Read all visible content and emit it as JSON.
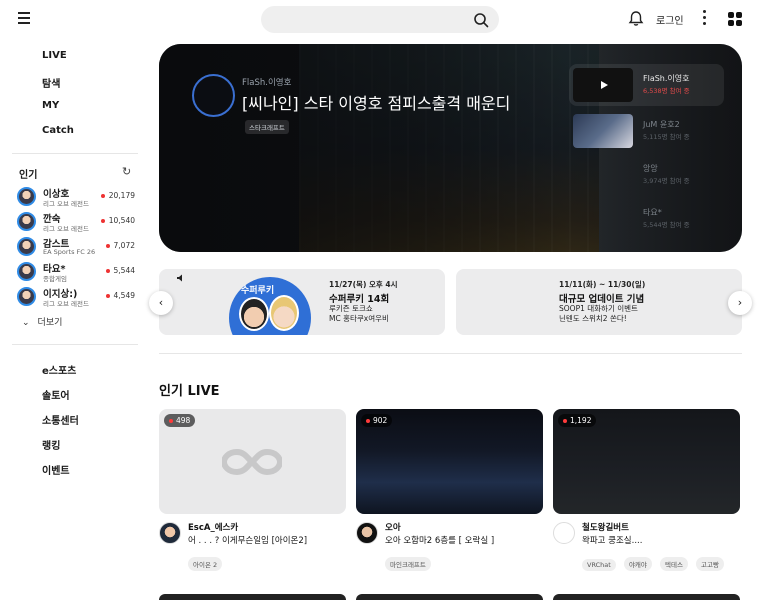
{
  "header": {
    "search_placeholder": "",
    "login_label": "로그인"
  },
  "sidebar": {
    "main_nav": [
      "LIVE",
      "탐색",
      "MY",
      "Catch"
    ],
    "popular_title": "인기",
    "streamers": [
      {
        "name": "이상호",
        "category": "리그 오브 레전드",
        "viewers": "20,179"
      },
      {
        "name": "깐숙",
        "category": "리그 오브 레전드",
        "viewers": "10,540"
      },
      {
        "name": "감스트",
        "category": "EA Sports FC 26",
        "viewers": "7,072"
      },
      {
        "name": "타요*",
        "category": "종합게임",
        "viewers": "5,544"
      },
      {
        "name": "이지상:)",
        "category": "리그 오브 레전드",
        "viewers": "4,549"
      }
    ],
    "more_label": "더보기",
    "extra_nav": [
      "e스포츠",
      "솔토어",
      "소통센터",
      "랭킹",
      "이벤트"
    ]
  },
  "banner": {
    "streamer": "FlaSh.이영호",
    "title": "[씨나인] 스타 이영호 점피스출격 매운디",
    "tag": "스타크래프트",
    "side_streams": [
      {
        "name": "FlaSh.이영호",
        "viewers": "6,538명 참여 중"
      },
      {
        "name": "JuM 윤호2",
        "viewers": "5,115명 참여 중"
      },
      {
        "name": "앙앙",
        "viewers": "3,974명 참여 중"
      },
      {
        "name": "타요*",
        "viewers": "5,544명 참여 중"
      }
    ]
  },
  "promos": [
    {
      "date": "11/27(목) 오후 4시",
      "title": "수퍼루키 14회",
      "sub1": "루키즌 토크쇼",
      "sub2": "MC 홍타쿠x여우비",
      "badge": "수퍼루키"
    },
    {
      "date": "11/11(화) ~ 11/30(일)",
      "title": "대규모 업데이트 기념",
      "sub1": "SOOP1 대화하기 이벤트",
      "sub2": "닌텐도 스위치2 쏜다!"
    }
  ],
  "section_title": "인기 LIVE",
  "live_cards": [
    {
      "viewers": "498",
      "channel": "EscA_에스카",
      "title": "어 . . . ? 이게무슨일임 [아이온2]",
      "tags": [
        "아이온 2"
      ]
    },
    {
      "viewers": "902",
      "channel": "오아",
      "title": "오아 오함마2 6층를 [ 오락실 ]",
      "tags": [
        "마인크래프트"
      ]
    },
    {
      "viewers": "1,192",
      "channel": "철도왕길버트",
      "title": "왁파고 쿵조실....",
      "tags": [
        "VRChat",
        "야캐야",
        "텍테스",
        "고고빵"
      ]
    }
  ],
  "colors": {
    "accent_blue": "#2f6fd6",
    "live_red": "#ff3b3b"
  }
}
